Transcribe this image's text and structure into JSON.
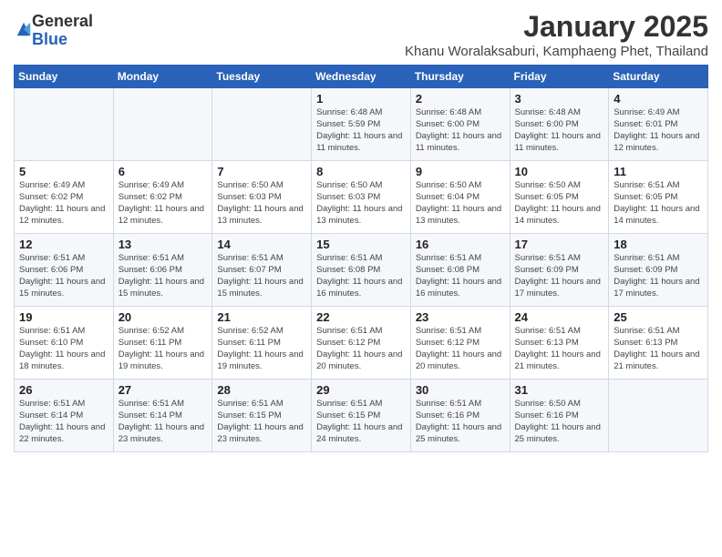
{
  "logo": {
    "general": "General",
    "blue": "Blue"
  },
  "title": "January 2025",
  "subtitle": "Khanu Woralaksaburi, Kamphaeng Phet, Thailand",
  "days_header": [
    "Sunday",
    "Monday",
    "Tuesday",
    "Wednesday",
    "Thursday",
    "Friday",
    "Saturday"
  ],
  "weeks": [
    [
      {
        "day": "",
        "info": ""
      },
      {
        "day": "",
        "info": ""
      },
      {
        "day": "",
        "info": ""
      },
      {
        "day": "1",
        "info": "Sunrise: 6:48 AM\nSunset: 5:59 PM\nDaylight: 11 hours and 11 minutes."
      },
      {
        "day": "2",
        "info": "Sunrise: 6:48 AM\nSunset: 6:00 PM\nDaylight: 11 hours and 11 minutes."
      },
      {
        "day": "3",
        "info": "Sunrise: 6:48 AM\nSunset: 6:00 PM\nDaylight: 11 hours and 11 minutes."
      },
      {
        "day": "4",
        "info": "Sunrise: 6:49 AM\nSunset: 6:01 PM\nDaylight: 11 hours and 12 minutes."
      }
    ],
    [
      {
        "day": "5",
        "info": "Sunrise: 6:49 AM\nSunset: 6:02 PM\nDaylight: 11 hours and 12 minutes."
      },
      {
        "day": "6",
        "info": "Sunrise: 6:49 AM\nSunset: 6:02 PM\nDaylight: 11 hours and 12 minutes."
      },
      {
        "day": "7",
        "info": "Sunrise: 6:50 AM\nSunset: 6:03 PM\nDaylight: 11 hours and 13 minutes."
      },
      {
        "day": "8",
        "info": "Sunrise: 6:50 AM\nSunset: 6:03 PM\nDaylight: 11 hours and 13 minutes."
      },
      {
        "day": "9",
        "info": "Sunrise: 6:50 AM\nSunset: 6:04 PM\nDaylight: 11 hours and 13 minutes."
      },
      {
        "day": "10",
        "info": "Sunrise: 6:50 AM\nSunset: 6:05 PM\nDaylight: 11 hours and 14 minutes."
      },
      {
        "day": "11",
        "info": "Sunrise: 6:51 AM\nSunset: 6:05 PM\nDaylight: 11 hours and 14 minutes."
      }
    ],
    [
      {
        "day": "12",
        "info": "Sunrise: 6:51 AM\nSunset: 6:06 PM\nDaylight: 11 hours and 15 minutes."
      },
      {
        "day": "13",
        "info": "Sunrise: 6:51 AM\nSunset: 6:06 PM\nDaylight: 11 hours and 15 minutes."
      },
      {
        "day": "14",
        "info": "Sunrise: 6:51 AM\nSunset: 6:07 PM\nDaylight: 11 hours and 15 minutes."
      },
      {
        "day": "15",
        "info": "Sunrise: 6:51 AM\nSunset: 6:08 PM\nDaylight: 11 hours and 16 minutes."
      },
      {
        "day": "16",
        "info": "Sunrise: 6:51 AM\nSunset: 6:08 PM\nDaylight: 11 hours and 16 minutes."
      },
      {
        "day": "17",
        "info": "Sunrise: 6:51 AM\nSunset: 6:09 PM\nDaylight: 11 hours and 17 minutes."
      },
      {
        "day": "18",
        "info": "Sunrise: 6:51 AM\nSunset: 6:09 PM\nDaylight: 11 hours and 17 minutes."
      }
    ],
    [
      {
        "day": "19",
        "info": "Sunrise: 6:51 AM\nSunset: 6:10 PM\nDaylight: 11 hours and 18 minutes."
      },
      {
        "day": "20",
        "info": "Sunrise: 6:52 AM\nSunset: 6:11 PM\nDaylight: 11 hours and 19 minutes."
      },
      {
        "day": "21",
        "info": "Sunrise: 6:52 AM\nSunset: 6:11 PM\nDaylight: 11 hours and 19 minutes."
      },
      {
        "day": "22",
        "info": "Sunrise: 6:51 AM\nSunset: 6:12 PM\nDaylight: 11 hours and 20 minutes."
      },
      {
        "day": "23",
        "info": "Sunrise: 6:51 AM\nSunset: 6:12 PM\nDaylight: 11 hours and 20 minutes."
      },
      {
        "day": "24",
        "info": "Sunrise: 6:51 AM\nSunset: 6:13 PM\nDaylight: 11 hours and 21 minutes."
      },
      {
        "day": "25",
        "info": "Sunrise: 6:51 AM\nSunset: 6:13 PM\nDaylight: 11 hours and 21 minutes."
      }
    ],
    [
      {
        "day": "26",
        "info": "Sunrise: 6:51 AM\nSunset: 6:14 PM\nDaylight: 11 hours and 22 minutes."
      },
      {
        "day": "27",
        "info": "Sunrise: 6:51 AM\nSunset: 6:14 PM\nDaylight: 11 hours and 23 minutes."
      },
      {
        "day": "28",
        "info": "Sunrise: 6:51 AM\nSunset: 6:15 PM\nDaylight: 11 hours and 23 minutes."
      },
      {
        "day": "29",
        "info": "Sunrise: 6:51 AM\nSunset: 6:15 PM\nDaylight: 11 hours and 24 minutes."
      },
      {
        "day": "30",
        "info": "Sunrise: 6:51 AM\nSunset: 6:16 PM\nDaylight: 11 hours and 25 minutes."
      },
      {
        "day": "31",
        "info": "Sunrise: 6:50 AM\nSunset: 6:16 PM\nDaylight: 11 hours and 25 minutes."
      },
      {
        "day": "",
        "info": ""
      }
    ]
  ]
}
